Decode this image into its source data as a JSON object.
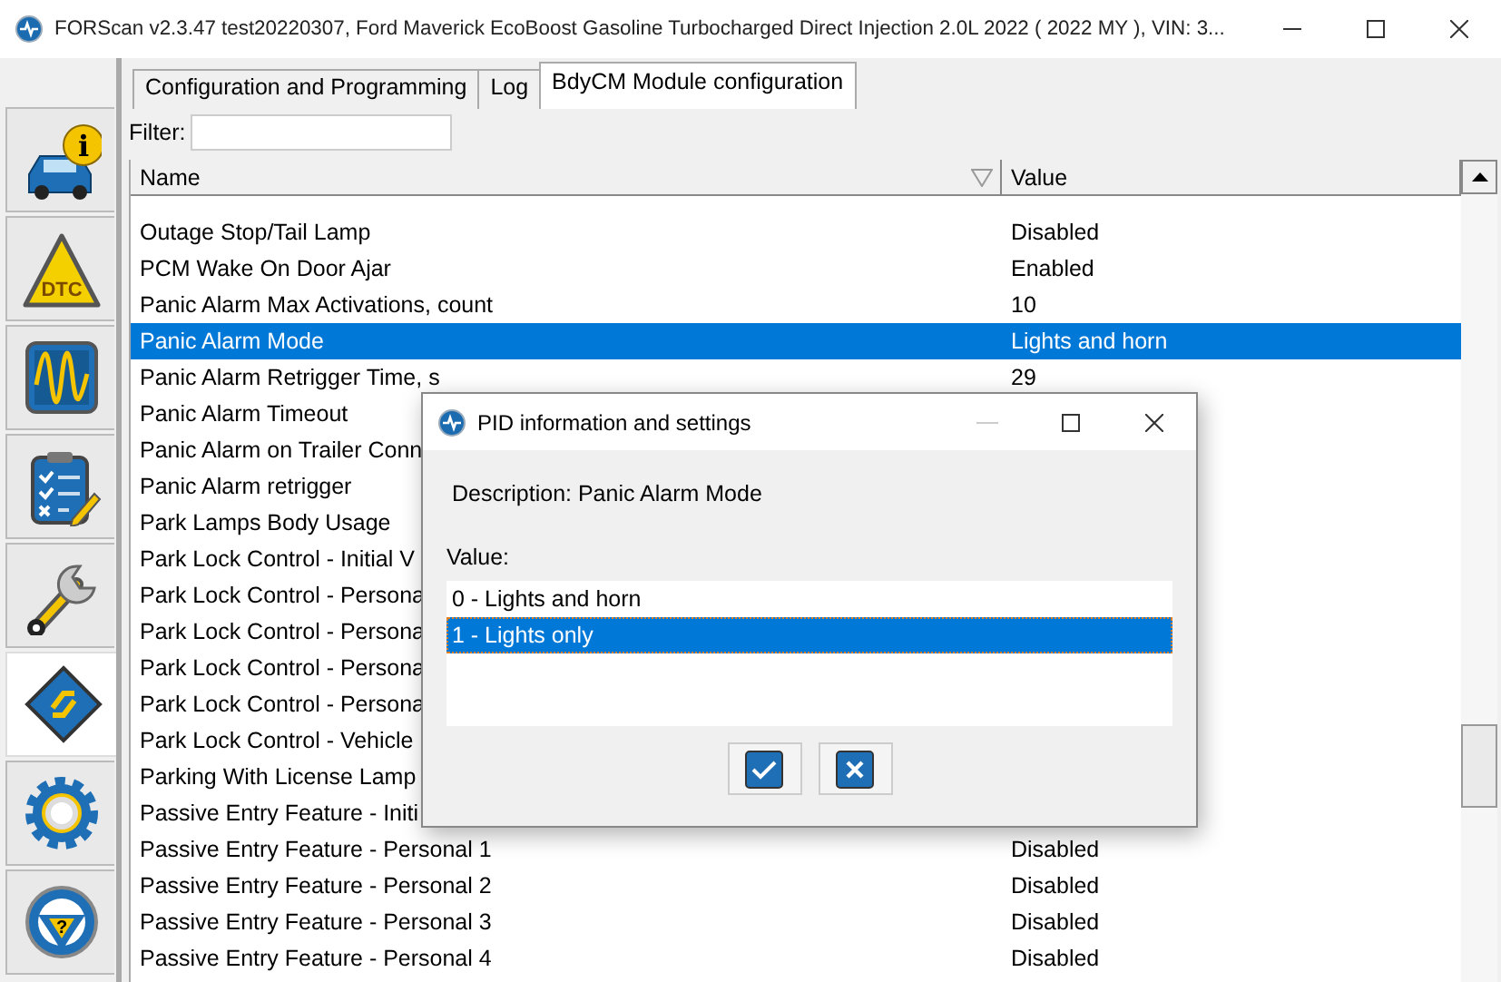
{
  "window": {
    "title": "FORScan v2.3.47 test20220307, Ford Maverick EcoBoost Gasoline Turbocharged Direct Injection 2.0L 2022 ( 2022 MY ), VIN: 3..."
  },
  "sidebar": {
    "items": [
      {
        "selected": false,
        "icon_text": "i"
      },
      {
        "selected": false,
        "icon_text": "DTC"
      },
      {
        "selected": false
      },
      {
        "selected": false
      },
      {
        "selected": false
      },
      {
        "selected": true
      },
      {
        "selected": false
      },
      {
        "selected": false,
        "icon_text": "?"
      }
    ]
  },
  "tabs": [
    {
      "label": "Configuration and Programming",
      "selected": false
    },
    {
      "label": "Log",
      "selected": false
    },
    {
      "label": "BdyCM Module configuration",
      "selected": true
    }
  ],
  "filter": {
    "label": "Filter:"
  },
  "table": {
    "columns": [
      "Name",
      "Value"
    ],
    "rows": [
      {
        "name": "Outage Stop/Tail Lamp",
        "value": "Disabled",
        "selected": false
      },
      {
        "name": "PCM Wake On Door Ajar",
        "value": "Enabled",
        "selected": false
      },
      {
        "name": "Panic Alarm Max Activations, count",
        "value": "10",
        "selected": false
      },
      {
        "name": "Panic Alarm Mode",
        "value": "Lights and horn",
        "selected": true
      },
      {
        "name": "Panic Alarm Retrigger Time, s",
        "value": "29",
        "selected": false
      },
      {
        "name": "Panic Alarm Timeout",
        "selected": false
      },
      {
        "name": "Panic Alarm on Trailer Conn",
        "selected": false
      },
      {
        "name": "Panic Alarm retrigger",
        "selected": false
      },
      {
        "name": "Park Lamps Body Usage",
        "selected": false
      },
      {
        "name": "Park Lock Control - Initial V",
        "selected": false
      },
      {
        "name": "Park Lock Control - Persona",
        "selected": false
      },
      {
        "name": "Park Lock Control - Persona",
        "selected": false
      },
      {
        "name": "Park Lock Control - Persona",
        "selected": false
      },
      {
        "name": "Park Lock Control - Persona",
        "selected": false
      },
      {
        "name": "Park Lock Control - Vehicle",
        "selected": false
      },
      {
        "name": "Parking With License Lamp",
        "selected": false
      },
      {
        "name": "Passive Entry Feature - Initi",
        "selected": false
      },
      {
        "name": "Passive Entry Feature - Personal 1",
        "value": "Disabled",
        "selected": false
      },
      {
        "name": "Passive Entry Feature - Personal 2",
        "value": "Disabled",
        "selected": false
      },
      {
        "name": "Passive Entry Feature - Personal 3",
        "value": "Disabled",
        "selected": false
      },
      {
        "name": "Passive Entry Feature - Personal 4",
        "value": "Disabled",
        "selected": false
      }
    ]
  },
  "dialog": {
    "title": "PID information and settings",
    "description": "Description: Panic Alarm Mode",
    "value_label": "Value:",
    "options": [
      {
        "label": "0 - Lights and horn",
        "selected": false
      },
      {
        "label": "1 - Lights only",
        "selected": true
      }
    ],
    "buttons": [
      {
        "kind": "ok"
      },
      {
        "kind": "cancel"
      }
    ]
  }
}
